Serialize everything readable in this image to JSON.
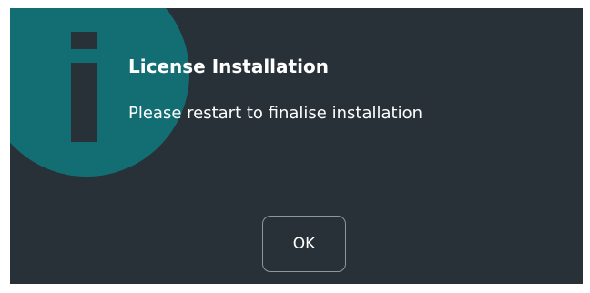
{
  "dialog": {
    "icon": "info-icon",
    "title": "License Installation",
    "message": "Please restart to finalise installation",
    "ok_label": "OK"
  },
  "colors": {
    "background": "#283137",
    "icon_circle": "#136e73",
    "text": "#ffffff",
    "button_border": "#8f979b"
  }
}
